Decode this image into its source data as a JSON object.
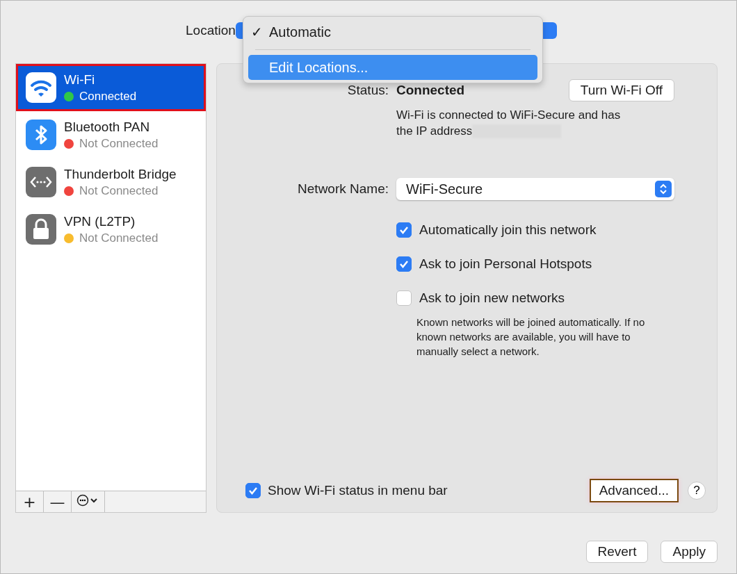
{
  "location": {
    "label": "Location",
    "check_mark": "✓",
    "menu": [
      {
        "label": "Automatic",
        "checked": true,
        "selected": false
      },
      {
        "label": "Edit Locations...",
        "checked": false,
        "selected": true
      }
    ]
  },
  "sidebar": {
    "items": [
      {
        "name": "Wi-Fi",
        "status": "Connected",
        "kind": "wifi",
        "color": "#30c748",
        "selected": true,
        "highlighted": true
      },
      {
        "name": "Bluetooth PAN",
        "status": "Not Connected",
        "kind": "bluetooth",
        "color": "#f0443e",
        "selected": false,
        "highlighted": false
      },
      {
        "name": "Thunderbolt Bridge",
        "status": "Not Connected",
        "kind": "bridge",
        "color": "#f0443e",
        "selected": false,
        "highlighted": false
      },
      {
        "name": "VPN (L2TP)",
        "status": "Not Connected",
        "kind": "vpn",
        "color": "#f8bc2e",
        "selected": false,
        "highlighted": false
      }
    ],
    "toolbar": [
      "+",
      "—"
    ]
  },
  "panel": {
    "status_label": "Status:",
    "status_value": "Connected",
    "toggle_button": "Turn Wi-Fi Off",
    "description": [
      "Wi-Fi is connected to WiFi-Secure and has",
      "the IP address"
    ],
    "network_label": "Network Name:",
    "network_value": "WiFi-Secure",
    "options": [
      {
        "label": "Automatically join this network",
        "checked": true
      },
      {
        "label": "Ask to join Personal Hotspots",
        "checked": true
      },
      {
        "label": "Ask to join new networks",
        "checked": false
      }
    ],
    "note": "Known networks will be joined automatically. If no known networks are available, you will have to manually select a network.",
    "menu_bar_option": {
      "label": "Show Wi-Fi status in menu bar",
      "checked": true
    },
    "advanced_button": {
      "label": "Advanced...",
      "highlighted": true
    },
    "help_button": "?"
  },
  "buttons": [
    "Revert",
    "Apply"
  ]
}
